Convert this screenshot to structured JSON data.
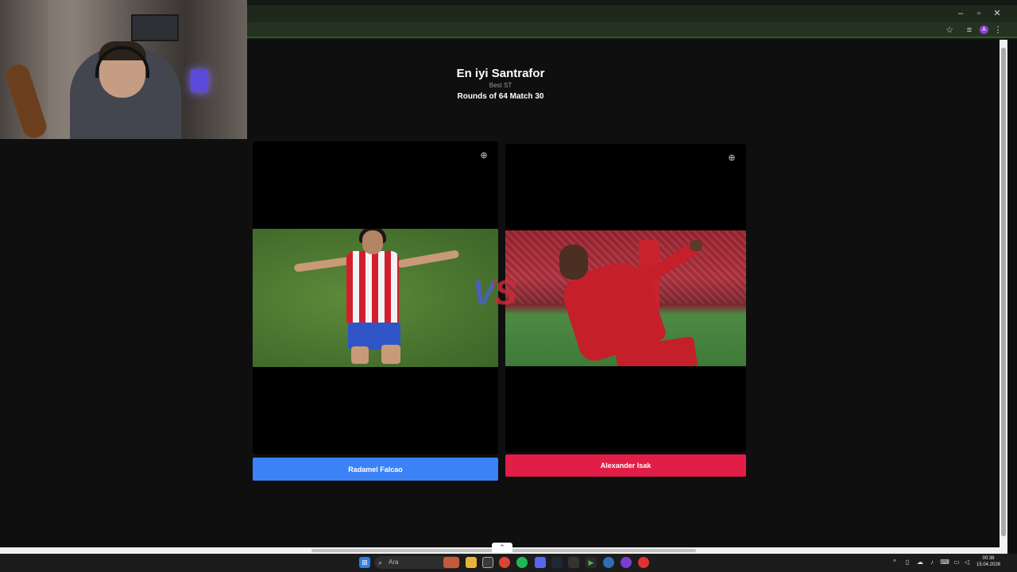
{
  "browser": {
    "window_controls": {
      "minimize": "–",
      "restore": "▫",
      "close": "✕"
    }
  },
  "page": {
    "title": "En iyi Santrafor",
    "subtitle": "Best ST",
    "round_info": "Rounds of 64 Match 30",
    "vs_text": "VS"
  },
  "matchup": {
    "left": {
      "name": "Radamel Falcao",
      "button_color": "#3b82f6"
    },
    "right": {
      "name": "Alexander Isak",
      "button_color": "#e11d48"
    }
  },
  "icons": {
    "zoom": "zoom-in-icon",
    "star": "star-icon",
    "profile_initial": "A"
  },
  "taskbar": {
    "search_placeholder": "Ara",
    "time": "00:38",
    "date": "15.04.2026"
  }
}
